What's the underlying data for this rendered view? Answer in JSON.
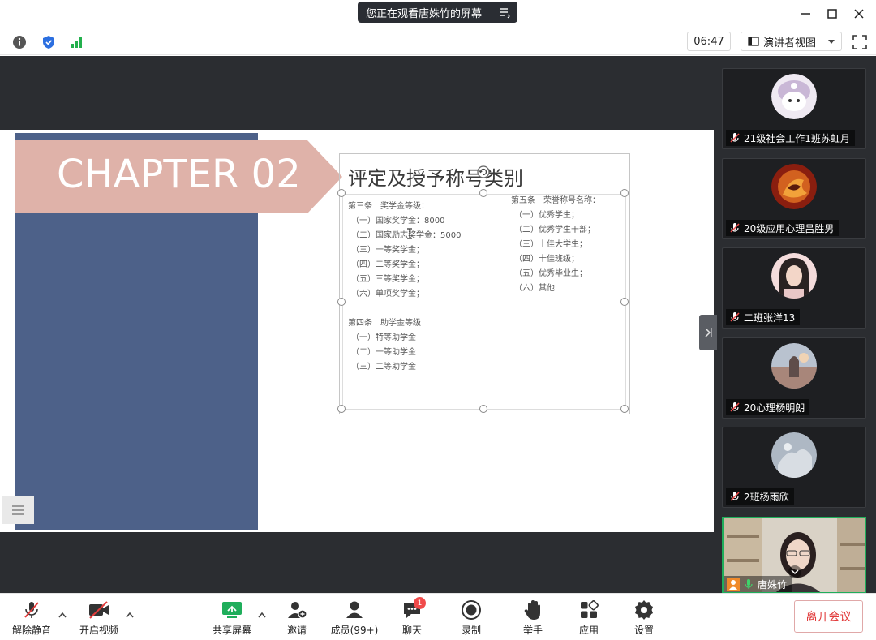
{
  "window": {
    "share_banner": "您正在观看唐姝竹的屏幕"
  },
  "infobar": {
    "timer": "06:47",
    "view_mode": "演讲者视图"
  },
  "slide": {
    "chapter": "CHAPTER 02",
    "title": "评定及授予称号类别",
    "left_col": {
      "section1": "第三条　奖学金等级：",
      "items1": [
        "（一）国家奖学金：8000",
        "（二）国家励志奖学金：5000",
        "（三）一等奖学金；",
        "（四）二等奖学金；",
        "（五）三等奖学金；",
        "（六）单项奖学金；"
      ],
      "section2": "第四条　助学金等级",
      "items2": [
        "（一）特等助学金",
        "（二）一等助学金",
        "（三）二等助学金"
      ]
    },
    "right_col": {
      "section": "第五条　荣誉称号名称：",
      "items": [
        "（一）优秀学生；",
        "（二）优秀学生干部；",
        "（三）十佳大学生；",
        "（四）十佳班级；",
        "（五）优秀毕业生；",
        "（六）其他"
      ]
    }
  },
  "participants": [
    {
      "name": "21级社会工作1班苏虹月",
      "avatar": "cartoon-avatar",
      "color": "#c9b7d6"
    },
    {
      "name": "20级应用心理吕胜男",
      "avatar": "fire-avatar",
      "color": "#d2611f"
    },
    {
      "name": "二班张洋13",
      "avatar": "girl-avatar",
      "color": "#e9c7c7"
    },
    {
      "name": "20心理杨明朗",
      "avatar": "sunset-avatar",
      "color": "#a8867a"
    },
    {
      "name": "2班杨雨欣",
      "avatar": "sky-avatar",
      "color": "#aeb8c4"
    }
  ],
  "presenter": {
    "name": "唐姝竹"
  },
  "toolbar": {
    "unmute": "解除静音",
    "start_video": "开启视频",
    "share_screen": "共享屏幕",
    "invite": "邀请",
    "members": "成员(99+)",
    "chat": "聊天",
    "chat_badge": "1",
    "record": "录制",
    "raise_hand": "举手",
    "apps": "应用",
    "settings": "设置",
    "leave": "离开会议"
  },
  "colors": {
    "accent_green": "#1fae5b",
    "leave_red": "#e23b3b",
    "slide_blue": "#4d6189",
    "banner_pink": "#dfb2a9"
  }
}
